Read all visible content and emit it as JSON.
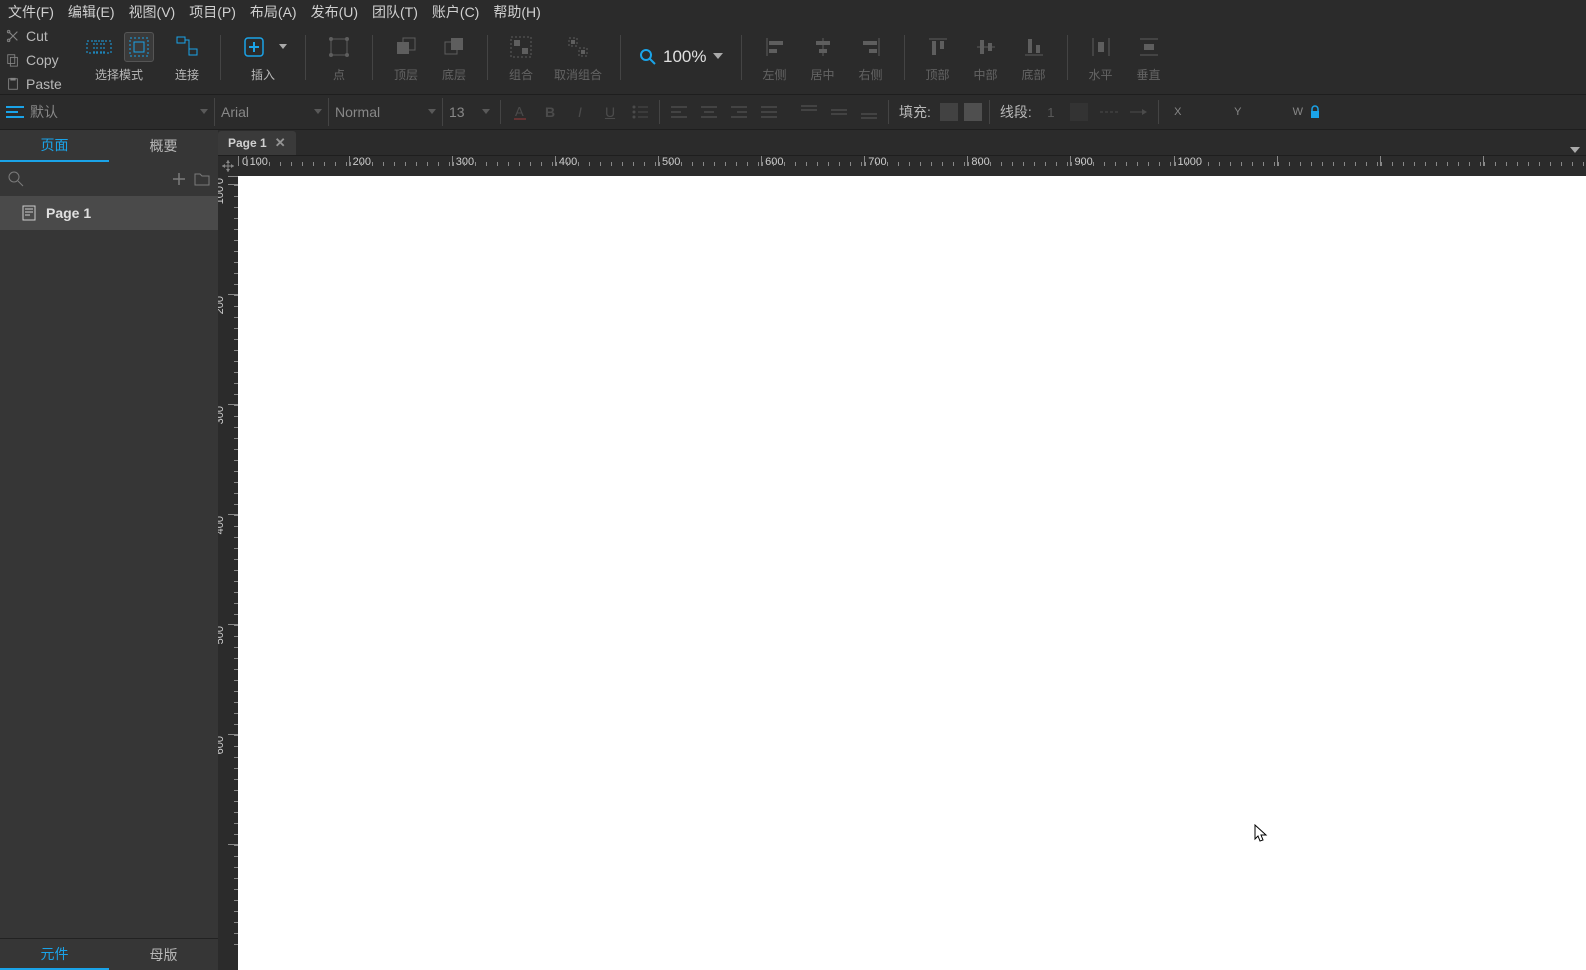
{
  "menu": {
    "file": "文件(F)",
    "edit": "编辑(E)",
    "view": "视图(V)",
    "project": "项目(P)",
    "layout": "布局(A)",
    "publish": "发布(U)",
    "team": "团队(T)",
    "account": "账户(C)",
    "help": "帮助(H)"
  },
  "editbar": {
    "cut": "Cut",
    "copy": "Copy",
    "paste": "Paste"
  },
  "toolbar": {
    "selmode": "选择模式",
    "connect": "连接",
    "insert": "插入",
    "point": "点",
    "front": "顶层",
    "back": "底层",
    "group": "组合",
    "ungroup": "取消组合",
    "left": "左侧",
    "center": "居中",
    "right": "右侧",
    "top": "顶部",
    "middle": "中部",
    "bottom": "底部",
    "horiz": "水平",
    "vert": "垂直"
  },
  "zoom": {
    "value": "100%"
  },
  "props": {
    "style": "默认",
    "font": "Arial",
    "weight": "Normal",
    "size": "13",
    "fill": "填充:",
    "line": "线段:",
    "lineval": "1",
    "x": "X",
    "y": "Y",
    "w": "W"
  },
  "tabs": {
    "page1": "Page 1"
  },
  "left": {
    "pages": "页面",
    "outline": "概要",
    "comp": "元件",
    "master": "母版",
    "page1": "Page 1"
  },
  "ruler": {
    "h": [
      "0",
      "100",
      "200",
      "300",
      "400",
      "500",
      "600",
      "700",
      "800",
      "900",
      "1000"
    ],
    "v": [
      "0",
      "100",
      "200",
      "300",
      "400",
      "500",
      "600"
    ]
  }
}
